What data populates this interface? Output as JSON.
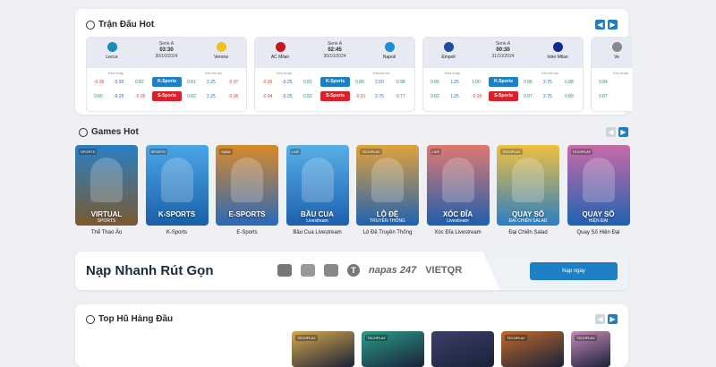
{
  "matches": {
    "title": "Trận Đấu Hot",
    "handicap_label": "Kèo chấp",
    "total_label": "Kèo tài xỉu",
    "items": [
      {
        "league": "Serie A",
        "time": "03:30",
        "date": "30/10/2024",
        "home": "Lecce",
        "away": "Verona",
        "home_color": "#1e8ab8",
        "away_color": "#f0c020",
        "rows": [
          {
            "book": "K-Sports",
            "v": [
              "-0.96",
              "-0.50",
              "0.82",
              "0.81",
              "2.25",
              "-0.97"
            ]
          },
          {
            "book": "S-Sports",
            "v": [
              "0.80",
              "-0.25",
              "-0.95",
              "0.82",
              "2.25",
              "-0.96"
            ]
          }
        ]
      },
      {
        "league": "Serie A",
        "time": "02:45",
        "date": "30/10/2024",
        "home": "AC Milan",
        "away": "Napoli",
        "home_color": "#c4161c",
        "away_color": "#1c8fd6",
        "rows": [
          {
            "book": "K-Sports",
            "v": [
              "-0.95",
              "-0.25",
              "0.81",
              "0.86",
              "2.50",
              "0.98"
            ]
          },
          {
            "book": "S-Sports",
            "v": [
              "-0.94",
              "-0.25",
              "0.82",
              "-0.91",
              "2.75",
              "0.77"
            ]
          }
        ]
      },
      {
        "league": "Serie A",
        "time": "00:30",
        "date": "31/10/2024",
        "home": "Empoli",
        "away": "Inter Milan",
        "home_color": "#1d4e9a",
        "away_color": "#0b2d8c",
        "rows": [
          {
            "book": "K-Sports",
            "v": [
              "0.86",
              "1.25",
              "1.00",
              "0.96",
              "2.75",
              "0.88"
            ]
          },
          {
            "book": "S-Sports",
            "v": [
              "0.82",
              "1.25",
              "-0.99",
              "0.97",
              "2.75",
              "0.89"
            ]
          }
        ]
      },
      {
        "league": "",
        "time": "",
        "date": "",
        "home": "Ve",
        "away": "",
        "home_color": "#888888",
        "away_color": "#888888",
        "rows": [
          {
            "book": "",
            "v": [
              "0.84",
              "",
              "",
              "",
              "",
              ""
            ]
          },
          {
            "book": "",
            "v": [
              "0.87",
              "",
              "",
              "",
              "",
              ""
            ]
          }
        ]
      }
    ]
  },
  "games": {
    "title": "Games Hot",
    "items": [
      {
        "caption": "VIRTUAL",
        "sub": "SPORTS",
        "brand": "SPORTS",
        "name": "Thể Thao Ảo",
        "c1": "#2a7fc4",
        "c2": "#7a5a30"
      },
      {
        "caption": "K-SPORTS",
        "sub": "",
        "brand": "SPORTS",
        "name": "K-Sports",
        "c1": "#4aa6e6",
        "c2": "#1a5fa8"
      },
      {
        "caption": "E-SPORTS",
        "sub": "",
        "brand": "SABA",
        "name": "E-Sports",
        "c1": "#d88a2a",
        "c2": "#2a68b8"
      },
      {
        "caption": "BẦU CUA",
        "sub": "Livestream",
        "brand": "LIVE",
        "name": "Bầu Cua Livestream",
        "c1": "#56b0e8",
        "c2": "#1e5fae"
      },
      {
        "caption": "LÔ ĐỀ",
        "sub": "TRUYỀN THỐNG",
        "brand": "TECHPLAY",
        "name": "Lô Đề Truyền Thống",
        "c1": "#e2a23a",
        "c2": "#1f62b2"
      },
      {
        "caption": "XÓC ĐĨA",
        "sub": "Livestream",
        "brand": "LIVE",
        "name": "Xóc Đĩa Livestream",
        "c1": "#e07870",
        "c2": "#1e5fae"
      },
      {
        "caption": "QUAY SỐ",
        "sub": "ĐẠI CHIẾN SALAD",
        "brand": "TECHPLAY",
        "name": "Đại Chiến Salad",
        "c1": "#f0c040",
        "c2": "#2a7ec4"
      },
      {
        "caption": "QUAY SỐ",
        "sub": "HIỆN ĐẠI",
        "brand": "TECHPLAY",
        "name": "Quay Số Hiện Đại",
        "c1": "#c86aa8",
        "c2": "#1f62b2"
      }
    ]
  },
  "banner": {
    "title": "Nạp Nhanh Rút Gọn",
    "payments": [
      "momo",
      "napas 247",
      "VIETQR"
    ],
    "cta": "Nạp ngay"
  },
  "jackpot": {
    "title": "Top Hũ Hàng Đầu",
    "items": [
      {
        "brand": "TECHPLAY",
        "color": "#d8a84a"
      },
      {
        "brand": "TECHPLAY",
        "color": "#2a9c8a"
      },
      {
        "brand": "",
        "color": "#3a3f6a"
      },
      {
        "brand": "TECHPLAY",
        "color": "#c06a2a"
      },
      {
        "brand": "TECHPLAY",
        "color": "#c88ab8"
      }
    ]
  }
}
